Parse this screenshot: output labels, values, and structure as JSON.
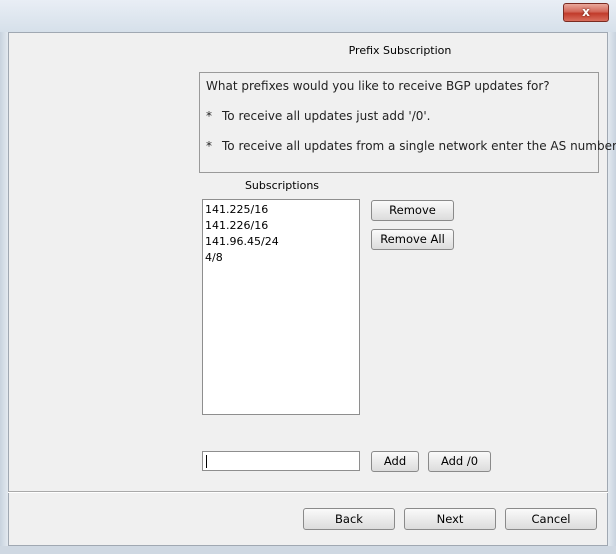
{
  "window": {
    "close_glyph": "x"
  },
  "wizard": {
    "title": "Prefix Subscription",
    "info_lines": [
      {
        "bullet": "",
        "text": "What prefixes would you like to receive BGP updates for?"
      },
      {
        "bullet": "*",
        "text": "To receive all updates just add '/0'."
      },
      {
        "bullet": "*",
        "text": "To receive all updates from a single network enter the AS number"
      }
    ],
    "subscriptions_label": "Subscriptions",
    "subscriptions": [
      "141.225/16",
      "141.226/16",
      "141.96.45/24",
      "4/8"
    ],
    "remove_label": "Remove",
    "remove_all_label": "Remove All",
    "prefix_input_value": "",
    "add_label": "Add",
    "add_zero_label": "Add /0"
  },
  "footer": {
    "back_label": "Back",
    "next_label": "Next",
    "cancel_label": "Cancel"
  }
}
